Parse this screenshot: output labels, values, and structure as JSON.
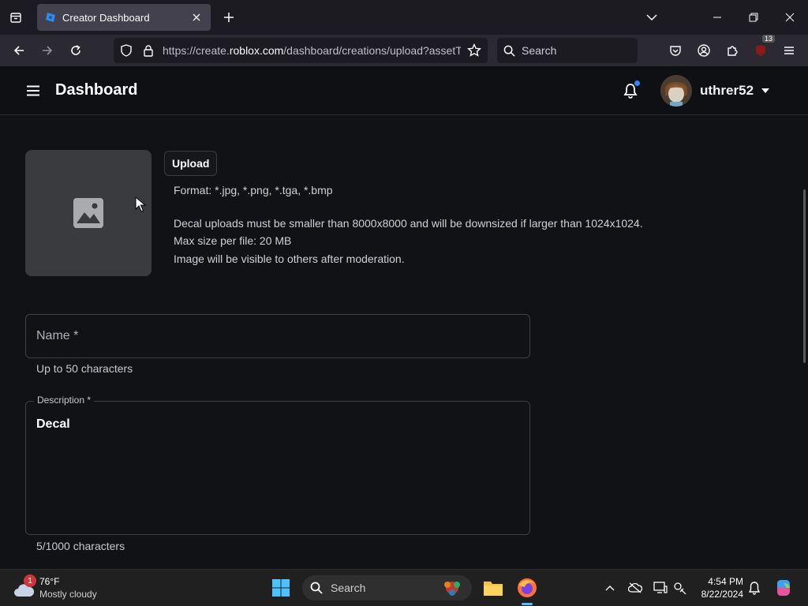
{
  "browser": {
    "tab_title": "Creator Dashboard",
    "url_prefix": "https://create.",
    "url_domain": "roblox.com",
    "url_suffix": "/dashboard/creations/upload?assetTy",
    "search_placeholder": "Search",
    "extension_badge": "13"
  },
  "header": {
    "title": "Dashboard",
    "username": "uthrer52"
  },
  "upload": {
    "button_label": "Upload",
    "format_text": "Format: *.jpg, *.png, *.tga, *.bmp",
    "size_text": "Decal uploads must be smaller than 8000x8000 and will be downsized if larger than 1024x1024.",
    "max_size_text": "Max size per file: 20 MB",
    "moderation_text": "Image will be visible to others after moderation."
  },
  "form": {
    "name_label": "Name *",
    "name_hint": "Up to 50 characters",
    "description_label": "Description *",
    "description_value": "Decal",
    "description_hint": "5/1000 characters"
  },
  "taskbar": {
    "weather_badge": "1",
    "temperature": "76°F",
    "condition": "Mostly cloudy",
    "search_placeholder": "Search",
    "time": "4:54 PM",
    "date": "8/22/2024"
  },
  "colors": {
    "background": "#111216",
    "accent": "#3b82f6"
  }
}
